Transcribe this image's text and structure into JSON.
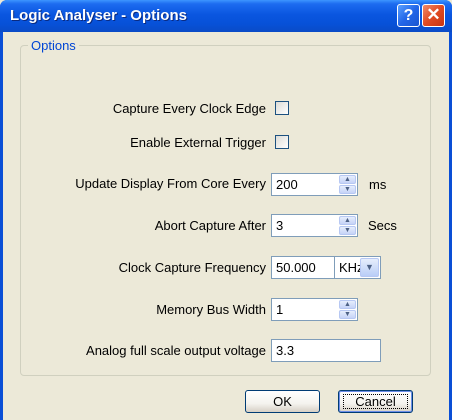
{
  "window": {
    "title": "Logic Analyser - Options",
    "help_glyph": "?",
    "close_glyph": "✕"
  },
  "group": {
    "legend": "Options"
  },
  "options": {
    "capture_every_clock_edge": {
      "label": "Capture Every Clock Edge",
      "checked": false
    },
    "enable_external_trigger": {
      "label": "Enable External Trigger",
      "checked": false
    },
    "update_display": {
      "label": "Update Display From Core Every",
      "value": "200",
      "unit": "ms"
    },
    "abort_capture": {
      "label": "Abort Capture After",
      "value": "3",
      "unit": "Secs"
    },
    "clock_capture_frequency": {
      "label": "Clock Capture Frequency",
      "value": "50.000",
      "unit_selected": "KHz"
    },
    "memory_bus_width": {
      "label": "Memory Bus Width",
      "value": "1"
    },
    "analog_full_scale": {
      "label": "Analog full scale output voltage",
      "value": "3.3"
    }
  },
  "buttons": {
    "ok": "OK",
    "cancel": "Cancel"
  },
  "icons": {
    "spin_up": "▲",
    "spin_down": "▼",
    "dropdown": "▼"
  }
}
